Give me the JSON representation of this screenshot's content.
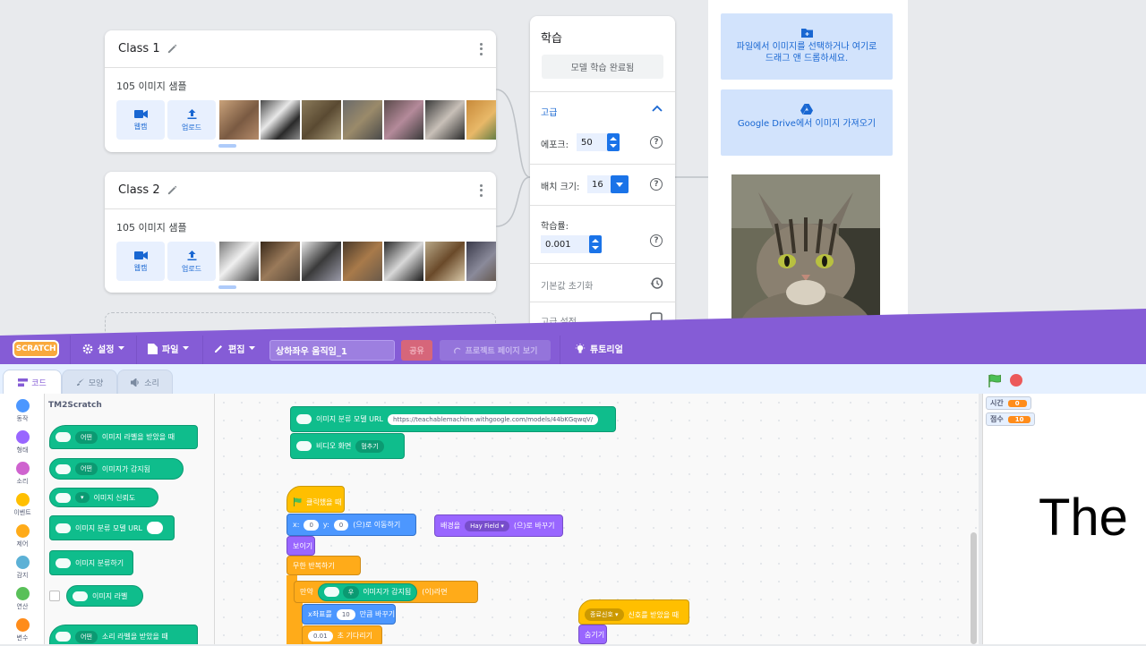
{
  "tm": {
    "classes": [
      {
        "name": "Class 1",
        "samples": "105 이미지 샘플",
        "webcam": "웹캠",
        "upload": "업로드"
      },
      {
        "name": "Class 2",
        "samples": "105 이미지 샘플",
        "webcam": "웹캠",
        "upload": "업로드"
      }
    ],
    "training": {
      "title": "학습",
      "done_button": "모델 학습 완료됨",
      "advanced": "고급",
      "epochs_label": "에포크:",
      "epochs_value": "50",
      "batch_label": "배치 크기:",
      "batch_value": "16",
      "lr_label": "학습률:",
      "lr_value": "0.001",
      "reset": "기본값 초기화",
      "adv_settings": "고급 설정",
      "help_glyph": "?"
    },
    "preview": {
      "file_text": "파일에서 이미지를 선택하거나 여기로 드래그 앤 드롭하세요.",
      "drive_text": "Google Drive에서 이미지 가져오기"
    }
  },
  "scratch": {
    "logo": "SCRATCH",
    "menu": {
      "settings": "설정",
      "file": "파일",
      "edit": "편집",
      "project_title": "상하좌우 움직임_1",
      "share": "공유",
      "see_project": "프로젝트 페이지 보기",
      "tutorials": "튜토리얼"
    },
    "tabs": {
      "code": "코드",
      "costumes": "모양",
      "sounds": "소리"
    },
    "categories": [
      {
        "label": "동작",
        "color": "#4c97ff"
      },
      {
        "label": "형태",
        "color": "#9966ff"
      },
      {
        "label": "소리",
        "color": "#cf63cf"
      },
      {
        "label": "이벤트",
        "color": "#ffbf00"
      },
      {
        "label": "제어",
        "color": "#ffab19"
      },
      {
        "label": "감지",
        "color": "#5cb1d6"
      },
      {
        "label": "연산",
        "color": "#59c059"
      },
      {
        "label": "변수",
        "color": "#ff8c1a"
      }
    ],
    "palette": {
      "title": "TM2Scratch",
      "b1_dd": "어떤",
      "b1": "이미지 라벨을 받았을 때",
      "b2_dd": "어떤",
      "b2": "이미지가 감지됨",
      "b3": "이미지 신뢰도",
      "b4": "이미지 분류 모델 URL",
      "b5": "이미지 분류하기",
      "b6": "이미지 라벨",
      "b7_dd": "어떤",
      "b7": "소리 라벨을 받았을 때"
    },
    "script": {
      "url_label": "이미지 분류 모델 URL",
      "url_value": "https://teachablemachine.withgoogle.com/models/44bKGqwqV/",
      "video_label": "비디오 화면",
      "video_value": "멈추기",
      "flag_hat": "클릭했을 때",
      "x_label": "x:",
      "x_value": "0",
      "y_label": "y:",
      "y_value": "0",
      "goto_tail": "(으)로 이동하기",
      "backdrop_label": "배경을",
      "backdrop_value": "Hay Field",
      "backdrop_tail": "(으)로 바꾸기",
      "show": "보이기",
      "forever": "무한 반복하기",
      "if_label": "만약",
      "if_dd": "우",
      "if_mid": "이미지가 감지됨",
      "if_tail": "(이)라면",
      "changex_label": "x좌표를",
      "changex_value": "10",
      "changex_tail": "만큼 바꾸기",
      "wait_value": "0.01",
      "wait_tail": "초 기다리기",
      "recv_dd": "종료신호",
      "recv_tail": "신호를 받았을 때",
      "hide": "숨기기"
    },
    "stage": {
      "monitor1_label": "시간",
      "monitor1_value": "0",
      "monitor2_label": "점수",
      "monitor2_value": "10",
      "text": "The"
    }
  }
}
